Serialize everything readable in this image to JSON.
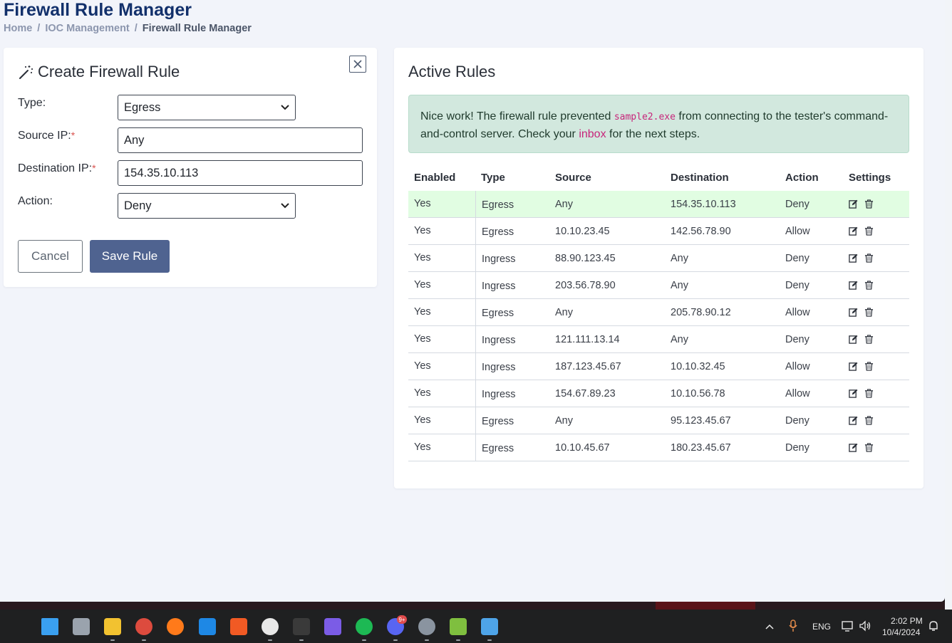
{
  "page": {
    "title": "Firewall Rule Manager",
    "breadcrumb": [
      "Home",
      "IOC Management",
      "Firewall Rule Manager"
    ],
    "breadcrumb_separator": "/"
  },
  "create_form": {
    "title": "Create Firewall Rule",
    "close_label": "×",
    "fields": {
      "type": {
        "label": "Type:",
        "value": "Egress"
      },
      "source_ip": {
        "label": "Source IP:",
        "required_mark": "*",
        "value": "Any"
      },
      "destination_ip": {
        "label": "Destination IP:",
        "required_mark": "*",
        "value": "154.35.10.113"
      },
      "action": {
        "label": "Action:",
        "value": "Deny"
      }
    },
    "cancel_label": "Cancel",
    "save_label": "Save Rule"
  },
  "rules": {
    "title": "Active Rules",
    "alert": {
      "text_before": "Nice work! The firewall rule prevented ",
      "code": "sample2.exe",
      "text_middle": " from connecting to the tester's command-and-control server. Check your ",
      "link": "inbox",
      "text_after": " for the next steps."
    },
    "columns": [
      "Enabled",
      "Type",
      "Source",
      "Destination",
      "Action",
      "Settings"
    ],
    "rows": [
      {
        "enabled": "Yes",
        "type": "Egress",
        "source": "Any",
        "destination": "154.35.10.113",
        "action": "Deny",
        "highlight": true
      },
      {
        "enabled": "Yes",
        "type": "Egress",
        "source": "10.10.23.45",
        "destination": "142.56.78.90",
        "action": "Allow"
      },
      {
        "enabled": "Yes",
        "type": "Ingress",
        "source": "88.90.123.45",
        "destination": "Any",
        "action": "Deny"
      },
      {
        "enabled": "Yes",
        "type": "Ingress",
        "source": "203.56.78.90",
        "destination": "Any",
        "action": "Deny"
      },
      {
        "enabled": "Yes",
        "type": "Egress",
        "source": "Any",
        "destination": "205.78.90.12",
        "action": "Allow"
      },
      {
        "enabled": "Yes",
        "type": "Ingress",
        "source": "121.111.13.14",
        "destination": "Any",
        "action": "Deny"
      },
      {
        "enabled": "Yes",
        "type": "Ingress",
        "source": "187.123.45.67",
        "destination": "10.10.32.45",
        "action": "Allow"
      },
      {
        "enabled": "Yes",
        "type": "Ingress",
        "source": "154.67.89.23",
        "destination": "10.10.56.78",
        "action": "Allow"
      },
      {
        "enabled": "Yes",
        "type": "Egress",
        "source": "Any",
        "destination": "95.123.45.67",
        "action": "Deny"
      },
      {
        "enabled": "Yes",
        "type": "Egress",
        "source": "10.10.45.67",
        "destination": "180.23.45.67",
        "action": "Deny"
      }
    ],
    "row_icons": [
      "edit-icon",
      "trash-icon"
    ]
  },
  "taskbar": {
    "apps": [
      {
        "name": "start-icon",
        "color": "#3aa0f0"
      },
      {
        "name": "task-view-icon",
        "color": "#9aa3ad"
      },
      {
        "name": "file-explorer-icon",
        "color": "#f2c230"
      },
      {
        "name": "chrome-icon",
        "color": "#dd4b3e"
      },
      {
        "name": "firefox-icon",
        "color": "#ff7a1a"
      },
      {
        "name": "virtual-machine-icon",
        "color": "#1e88e5"
      },
      {
        "name": "brave-icon",
        "color": "#f15a24"
      },
      {
        "name": "chatgpt-icon",
        "color": "#e8e8e8"
      },
      {
        "name": "terminal-icon",
        "color": "#3a3a3a"
      },
      {
        "name": "obsidian-icon",
        "color": "#7b5ce6"
      },
      {
        "name": "spotify-icon",
        "color": "#1db954"
      },
      {
        "name": "discord-icon",
        "color": "#5865f2"
      },
      {
        "name": "settings-icon",
        "color": "#8a94a0"
      },
      {
        "name": "notepad-plus-icon",
        "color": "#7fbf3f"
      },
      {
        "name": "notepad-icon",
        "color": "#4ea4e8"
      }
    ],
    "discord_badge": "9+",
    "language": "ENG",
    "time": "2:02 PM",
    "date": "10/4/2024"
  }
}
